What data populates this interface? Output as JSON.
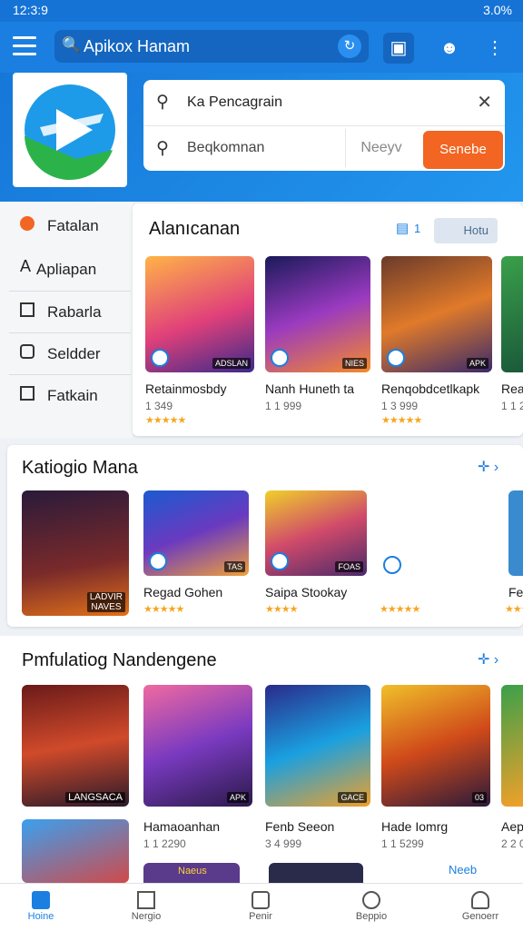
{
  "status": {
    "time": "12:3:9",
    "right": "3.0%"
  },
  "topbar": {
    "search_text": "Apikox Hanam"
  },
  "search": {
    "value": "Ka Pencagrain",
    "placeholder": "Beqkomnan",
    "mid_label": "Neeyv",
    "button": "Senebe"
  },
  "sidebar": {
    "items": [
      {
        "label": "Fatalan"
      },
      {
        "label": "Apliapan"
      },
      {
        "label": "Rabarla"
      },
      {
        "label": "Seldder"
      },
      {
        "label": "Fatkain"
      }
    ]
  },
  "section1": {
    "title": "Alanıcanan",
    "count": "1",
    "button": "Hotu",
    "apps": [
      {
        "name": "Retainmosbdy",
        "meta": "1 349",
        "stars": "★★★★★",
        "badge": "ADSLAN"
      },
      {
        "name": "Nanh Huneth ta",
        "meta": "1 1 999",
        "stars": "",
        "badge": "NIES"
      },
      {
        "name": "Renqobdcetlkapk",
        "meta": "1 3 999",
        "stars": "★★★★★",
        "badge": "APK"
      },
      {
        "name": "Rea",
        "meta": "1 1 2",
        "stars": "",
        "badge": ""
      }
    ]
  },
  "section2": {
    "title": "Katiogio Mana",
    "feature_text": "LADVIR\nNAVES",
    "apps": [
      {
        "name": "Regad Gohen",
        "stars": "★★★★★",
        "badge": "TAS"
      },
      {
        "name": "Saipa Stookay",
        "stars": "★★★★",
        "badge": "FOAS"
      },
      {
        "name": "",
        "stars": "★★★★★",
        "badge": ""
      },
      {
        "name": "Fe",
        "stars": "★★★★",
        "badge": ""
      }
    ]
  },
  "section3": {
    "title": "Pmfulatiog Nandengene",
    "feature_text": "LANGSACA",
    "apps": [
      {
        "name": "Hamaoanhan",
        "meta": "1 1 2290",
        "badge": "APK"
      },
      {
        "name": "Fenb Seeon",
        "meta": "3 4 999",
        "badge": "GACE"
      },
      {
        "name": "Hade Iomrg",
        "meta": "1 1 5299",
        "badge": "03"
      },
      {
        "name": "Aep",
        "meta": "2 2 0",
        "badge": ""
      }
    ],
    "row2_labels": [
      "Naeus",
      "Neeb"
    ]
  },
  "bottom_nav": [
    {
      "label": "Hoine",
      "icon": "home-icon"
    },
    {
      "label": "Nergio",
      "icon": "book-icon"
    },
    {
      "label": "Penir",
      "icon": "bag-icon"
    },
    {
      "label": "Beppio",
      "icon": "search-icon"
    },
    {
      "label": "Genoerr",
      "icon": "profile-icon"
    }
  ],
  "colors": {
    "primary": "#1a7fe0",
    "accent": "#f26522",
    "stars": "#f5a623"
  }
}
